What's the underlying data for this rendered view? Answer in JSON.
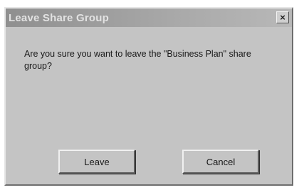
{
  "window": {
    "title": "Leave Share Group",
    "close_glyph": "×",
    "close_icon": "close-icon"
  },
  "message": "Are you sure you want to leave the \"Business Plan\" share group?",
  "buttons": {
    "leave": "Leave",
    "cancel": "Cancel"
  }
}
